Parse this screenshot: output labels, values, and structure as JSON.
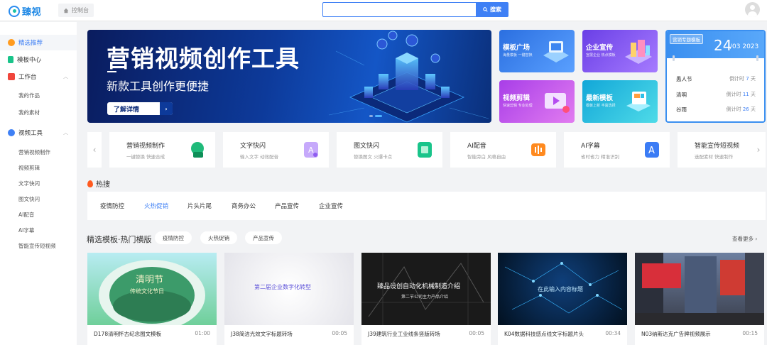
{
  "brand": {
    "logo_text": "臻视"
  },
  "topbar": {
    "home_label": "控制台",
    "search_placeholder": "",
    "search_button": "搜索"
  },
  "sidebar": {
    "items": [
      {
        "label": "精选推荐",
        "active": true
      },
      {
        "label": "模板中心"
      },
      {
        "label": "工作台",
        "expandable": true
      },
      {
        "label": "视频工具",
        "expandable": true
      }
    ],
    "workbench_sub": [
      "我的作品",
      "我的素材"
    ],
    "tools_sub": [
      "营销视频制作",
      "视频剪辑",
      "文字快闪",
      "图文快闪",
      "AI配音",
      "AI字幕",
      "智能宣传短视频"
    ]
  },
  "banner": {
    "title": "营销视频创作工具",
    "subtitle": "新款工具创作更便捷",
    "button": "了解详情"
  },
  "tiles": [
    {
      "title": "模板广场",
      "sub": "海量模板 一键替换",
      "color1": "#2b6fe0",
      "color2": "#5aa0ff"
    },
    {
      "title": "企业宣传",
      "sub": "宣展企业 热点模板",
      "color1": "#6a3fe6",
      "color2": "#a67bff"
    },
    {
      "title": "视频剪辑",
      "sub": "快速剪辑 专业处理",
      "color1": "#a83ee8",
      "color2": "#e27cf0"
    },
    {
      "title": "最新模板",
      "sub": "模板上新 丰富选择",
      "color1": "#12a7d8",
      "color2": "#4fdbe8"
    }
  ],
  "calendar": {
    "tag": "营销专题模板",
    "day": "24",
    "date": "/03 2023",
    "rows": [
      {
        "name": "愚人节",
        "prefix": "倒计时",
        "days": "7",
        "suffix": "天"
      },
      {
        "name": "清明",
        "prefix": "倒计时",
        "days": "11",
        "suffix": "天"
      },
      {
        "name": "谷雨",
        "prefix": "倒计时",
        "days": "26",
        "suffix": "天"
      }
    ]
  },
  "tools": [
    {
      "title": "营销视频制作",
      "sub": "一键替换 快速合成",
      "color": "#1fba7a"
    },
    {
      "title": "文字快闪",
      "sub": "输入文字 动效配音",
      "color": "#b28cf5"
    },
    {
      "title": "图文快闪",
      "sub": "替换图文 火爆卡点",
      "color": "#19c48a"
    },
    {
      "title": "AI配音",
      "sub": "智能旁白 风格自由",
      "color": "#ff8a1f"
    },
    {
      "title": "AI字幕",
      "sub": "省时省力 精准识别",
      "color": "#3b7cf5"
    },
    {
      "title": "智能宣传短视频",
      "sub": "选配素材 快速制作",
      "color": "#ffffff"
    }
  ],
  "hot": {
    "label": "热搜",
    "tabs": [
      "疫情防控",
      "火热促销",
      "片头片尾",
      "商务办公",
      "产品宣传",
      "企业宣传"
    ],
    "active_index": 1
  },
  "section": {
    "title": "精选模板·热门横版",
    "pills": [
      "疫情防控",
      "火热促销",
      "产品宣传"
    ],
    "more": "查看更多"
  },
  "cards": [
    {
      "title": "D178清明怀古纪念图文模板",
      "duration": "01:00",
      "thumb_text": "清明节",
      "thumb_sub": "传统文化节日"
    },
    {
      "title": "J38简洁光效文字标题转场",
      "duration": "00:05",
      "thumb_text": "第二届企业数字化转型",
      "thumb_sub": ""
    },
    {
      "title": "J39建筑行业工业线条竖版转场",
      "duration": "00:05",
      "thumb_text": "臻品设创自动化机械制造介绍",
      "thumb_sub": "第二节公司主力产品介绍"
    },
    {
      "title": "K04数据科技感点线文字标题片头",
      "duration": "00:34",
      "thumb_text": "在此输入内容标题",
      "thumb_sub": ""
    },
    {
      "title": "N03纳斯达克广告牌视频展示",
      "duration": "00:15",
      "thumb_text": "",
      "thumb_sub": ""
    }
  ]
}
